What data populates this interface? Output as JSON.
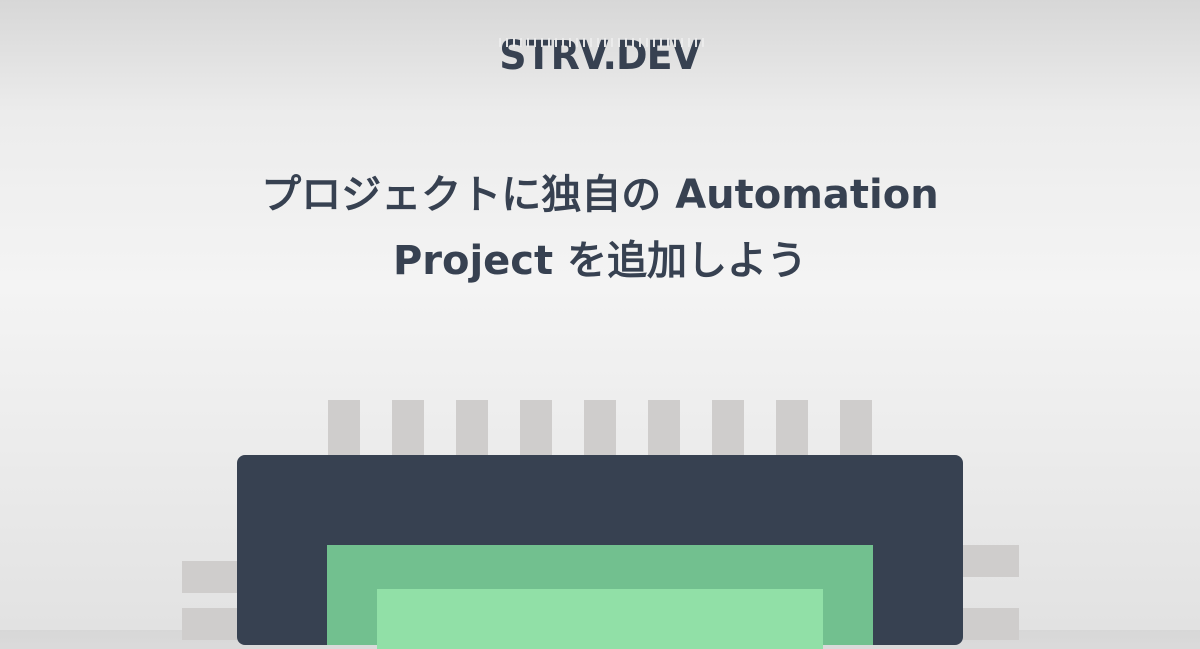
{
  "brand": {
    "logo_text": "STRV.DEV"
  },
  "headline": {
    "line1": "プロジェクトに独自の Automation",
    "line2": "Project を追加しよう"
  },
  "colors": {
    "text": "#374151",
    "chip_body": "#374151",
    "chip_die_outer": "#72c08f",
    "chip_die_inner": "#91e0a7",
    "chip_pins": "#cfcdcc",
    "background": "#f0f0f0"
  },
  "illustration": {
    "icon": "microchip-icon"
  }
}
